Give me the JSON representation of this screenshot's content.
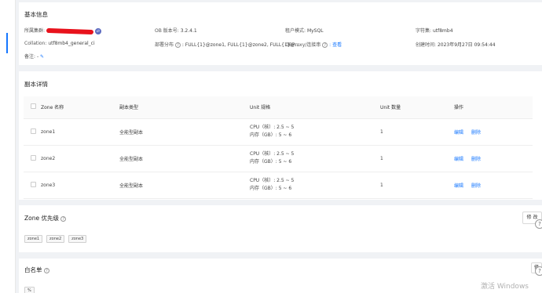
{
  "basic": {
    "title": "基本信息",
    "cluster_label": "所属集群:",
    "version_label": "OB 版本号:",
    "version_value": "3.2.4.1",
    "tenant_mode_label": "租户模式:",
    "tenant_mode_value": "MySQL",
    "charset_label": "字符集:",
    "charset_value": "utf8mb4",
    "collation_label": "Collation:",
    "collation_value": "utf8mb4_general_ci",
    "deploy_label": "部署分布",
    "deploy_value": ": FULL{1}@zone1, FULL{1}@zone2, FULL{1}@...",
    "obproxy_label": "OBProxy/连接串",
    "obproxy_link": ": 查看",
    "created_label": "创建时间:",
    "created_value": "2023年9月27日 09:54:44",
    "remark_label": "备注:",
    "remark_value": "-"
  },
  "replicas": {
    "title": "副本详情",
    "columns": [
      "Zone 名称",
      "副本类型",
      "Unit 规格",
      "Unit 数量",
      "操作"
    ],
    "rows": [
      {
        "zone": "zone1",
        "type": "全能型副本",
        "cpu": "CPU（核）: 2.5 ~ 5",
        "mem": "内存（GB）: 5 ~ 6",
        "count": "1",
        "edit": "编辑",
        "delete": "删除"
      },
      {
        "zone": "zone2",
        "type": "全能型副本",
        "cpu": "CPU（核）: 2.5 ~ 5",
        "mem": "内存（GB）: 5 ~ 6",
        "count": "1",
        "edit": "编辑",
        "delete": "删除"
      },
      {
        "zone": "zone3",
        "type": "全能型副本",
        "cpu": "CPU（核）: 2.5 ~ 5",
        "mem": "内存（GB）: 5 ~ 6",
        "count": "1",
        "edit": "编辑",
        "delete": "删除"
      }
    ]
  },
  "priority": {
    "title": "Zone 优先级",
    "modify_label": "修 改",
    "zones": [
      "zone1",
      "zone2",
      "zone3"
    ]
  },
  "whitelist": {
    "title": "白名单",
    "button_label": "修",
    "value": "%"
  },
  "watermark": "激活 Windows",
  "colors": {
    "accent": "#1677ff",
    "redaction": "#e8121c"
  }
}
